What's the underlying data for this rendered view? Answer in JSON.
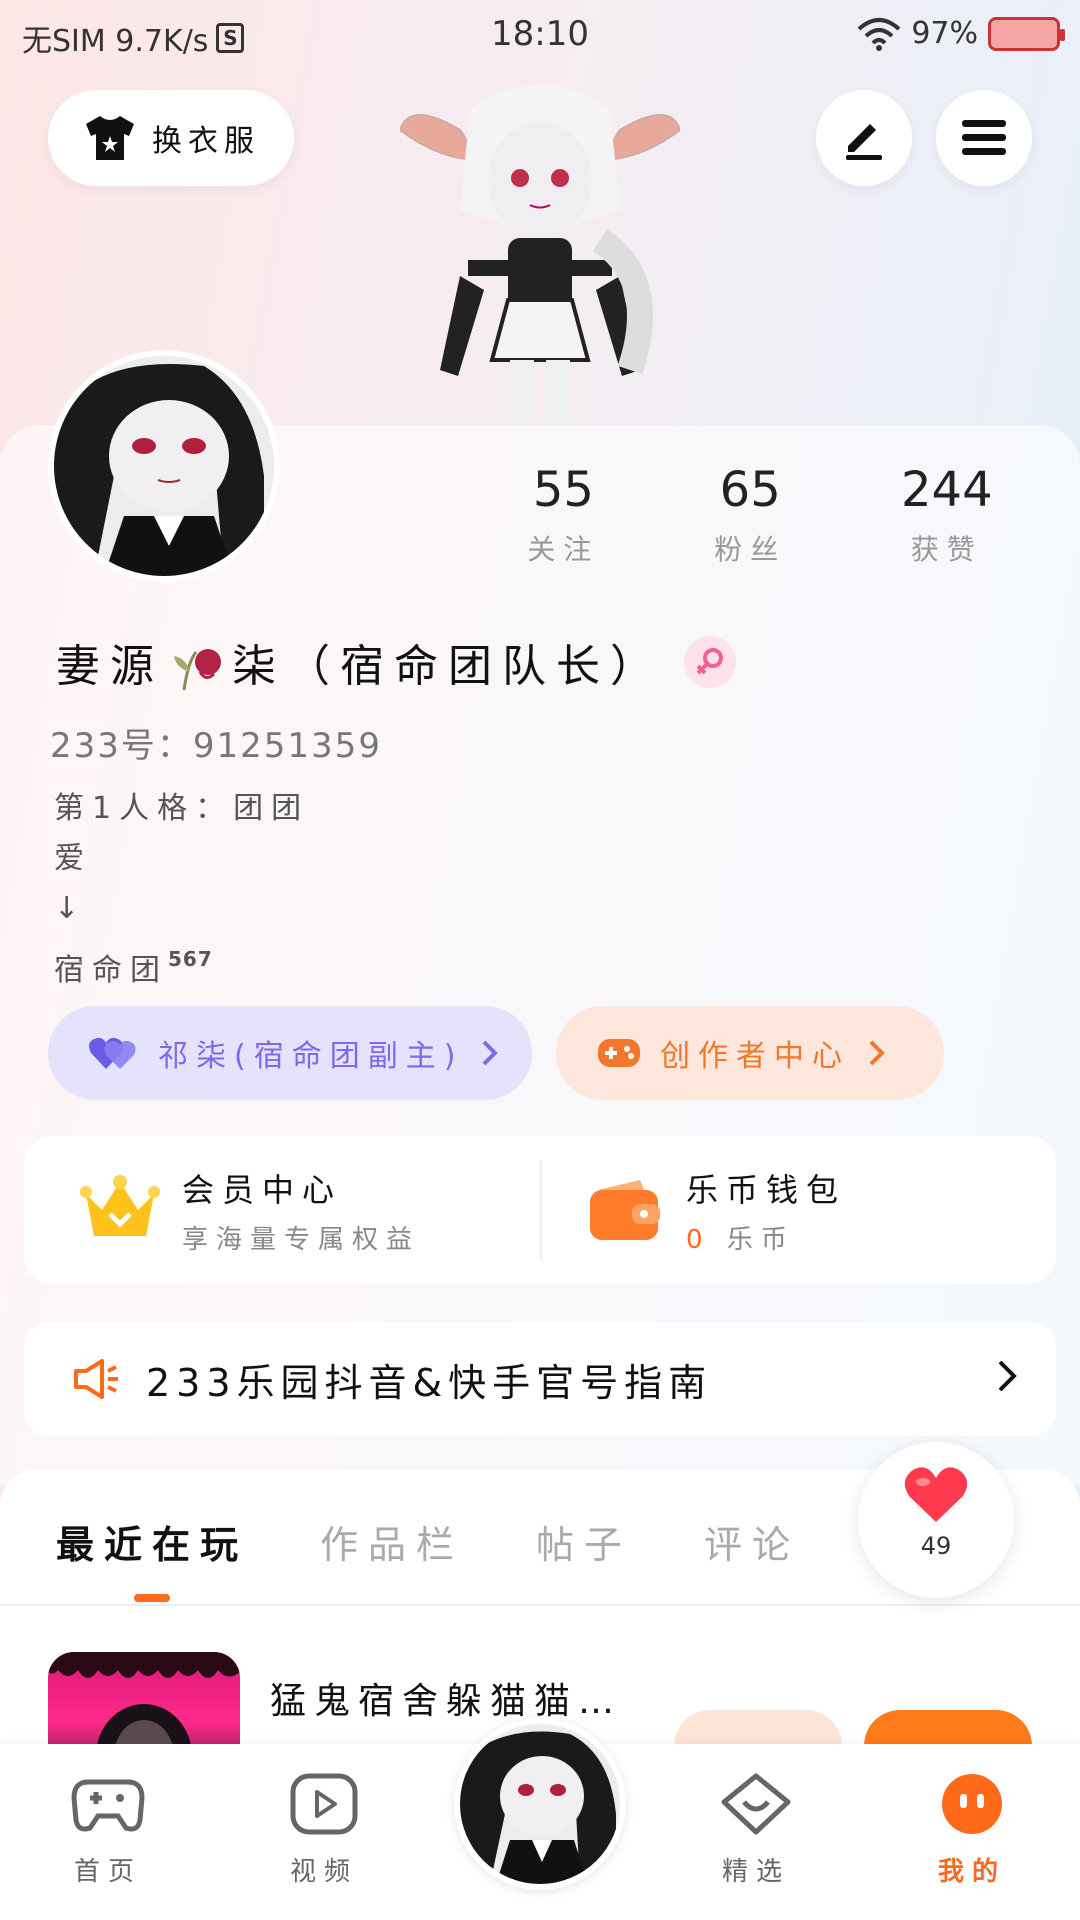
{
  "status_bar": {
    "carrier": "无SIM 9.7K/s",
    "s_icon": "S",
    "time": "18:10",
    "battery": "97%"
  },
  "header": {
    "dress_label": "换衣服",
    "icons": [
      "tshirt-icon",
      "pen-icon",
      "menu-icon"
    ]
  },
  "profile": {
    "stats": [
      {
        "value": "55",
        "label": "关注"
      },
      {
        "value": "65",
        "label": "粉丝"
      },
      {
        "value": "244",
        "label": "获赞"
      }
    ],
    "name_part1": "妻源",
    "name_part2": "柒（宿命团队长）",
    "gender_icon": "female-icon",
    "uid": "233号：91251359",
    "bio_line1": "第1人格：团团",
    "bio_line2": "爱",
    "bio_line3": "↓",
    "bio_line4": "宿命团",
    "bio_sup": "567"
  },
  "pills": {
    "left_label": "祁柒(宿命团副主)",
    "right_label": "创作者中心",
    "left_color": "#7b6bea",
    "right_color": "#f0772b"
  },
  "vip": {
    "member_title": "会员中心",
    "member_sub": "享海量专属权益",
    "wallet_title": "乐币钱包",
    "wallet_amount": "0",
    "wallet_unit": "乐币"
  },
  "notice": {
    "text": "233乐园抖音&快手官号指南"
  },
  "tabs": [
    {
      "label": "最近在玩",
      "active": true
    },
    {
      "label": "作品栏",
      "active": false
    },
    {
      "label": "帖子",
      "active": false
    },
    {
      "label": "评论",
      "active": false
    }
  ],
  "like": {
    "count": "49"
  },
  "recent_game": {
    "title": "猛鬼宿舍躲猫猫…"
  },
  "bottom_nav": [
    {
      "label": "首页",
      "icon": "gamepad-icon",
      "active": false
    },
    {
      "label": "视频",
      "icon": "play-icon",
      "active": false
    },
    {
      "label": "精选",
      "icon": "heart-badge-icon",
      "active": false
    },
    {
      "label": "我的",
      "icon": "face-icon",
      "active": true
    }
  ],
  "accent": "#ff6a1a"
}
